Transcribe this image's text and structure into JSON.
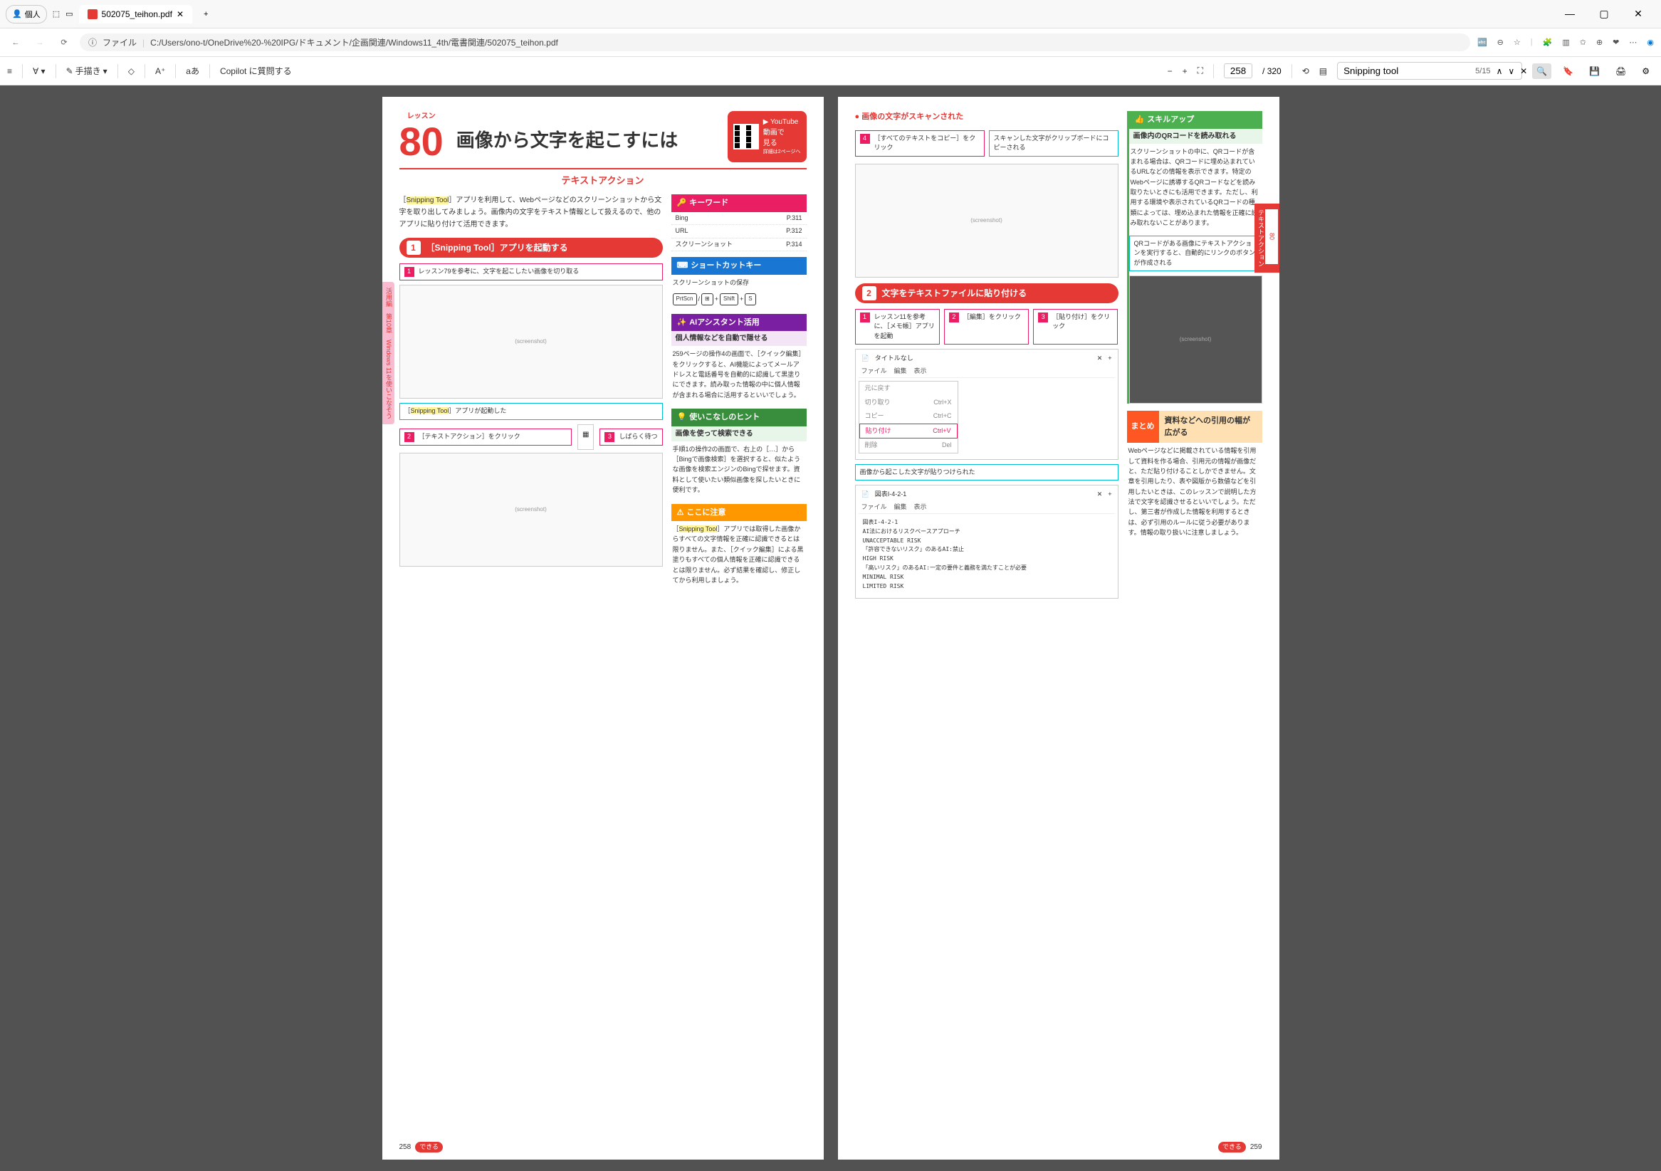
{
  "titlebar": {
    "profile": "個人",
    "tab_title": "502075_teihon.pdf"
  },
  "addressbar": {
    "file_label": "ファイル",
    "url": "C:/Users/ono-t/OneDrive%20-%20IPG/ドキュメント/企画関連/Windows11_4th/電書関連/502075_teihon.pdf"
  },
  "toolbar": {
    "draw": "手描き",
    "ask_copilot": "Copilot に質問する",
    "page_current": "258",
    "page_total": "/ 320",
    "search_value": "Snipping tool",
    "search_count": "5/15"
  },
  "left_page": {
    "lesson_label": "レッスン",
    "lesson_num": "80",
    "lesson_title": "画像から文字を起こすには",
    "qr_line1": "YouTube",
    "qr_line2": "動画で",
    "qr_line3": "見る",
    "qr_sub": "詳細は2ページへ",
    "subtitle": "テキストアクション",
    "intro": "［Snipping Tool］アプリを利用して、Webページなどのスクリーンショットから文字を取り出してみましょう。画像内の文字をテキスト情報として扱えるので、他のアプリに貼り付けて活用できます。",
    "intro_highlight": "Snipping Tool",
    "sec1_title": "［Snipping Tool］アプリを起動する",
    "step1_1": "レッスン79を参考に、文字を起こしたい画像を切り取る",
    "cyan1": "［Snipping Tool］アプリが起動した",
    "cyan1_highlight": "Snipping Tool",
    "step1_2": "［テキストアクション］をクリック",
    "step1_3": "しばらく待つ",
    "keyword_header": "キーワード",
    "keywords": [
      {
        "k": "Bing",
        "v": "P.311"
      },
      {
        "k": "URL",
        "v": "P.312"
      },
      {
        "k": "スクリーンショット",
        "v": "P.314"
      }
    ],
    "shortcut_header": "ショートカットキー",
    "shortcut_label": "スクリーンショットの保存",
    "shortcut_keys": [
      "PrtScn",
      "/",
      "⊞",
      "+",
      "Shift",
      "+",
      "S"
    ],
    "ai_header": "AIアシスタント活用",
    "ai_sub": "個人情報などを自動で隠せる",
    "ai_body": "259ページの操作4の画面で、［クイック編集］をクリックすると、AI機能によってメールアドレスと電話番号を自動的に認識して黒塗りにできます。読み取った情報の中に個人情報が含まれる場合に活用するといいでしょう。",
    "hint_header": "使いこなしのヒント",
    "hint_sub": "画像を使って検索できる",
    "hint_body": "手順1の操作2の画面で、右上の［…］から［Bingで画像検索］を選択すると、似たような画像を検索エンジンのBingで探せます。資料として使いたい類似画像を探したいときに便利です。",
    "warn_header": "ここに注意",
    "warn_body": "［Snipping Tool］アプリでは取得した画像からすべての文字情報を正確に認識できるとは限りません。また、［クイック編集］による黒塗りもすべての個人情報を正確に認識できるとは限りません。必ず結果を確認し、修正してから利用しましょう。",
    "warn_highlight": "Snipping Tool",
    "sidebar": "活用編　第10章　Windows 11を使いこなそう",
    "page_num": "258",
    "dekiru": "できる"
  },
  "right_page": {
    "scan_title": "画像の文字がスキャンされた",
    "step4": "［すべてのテキストをコピー］をクリック",
    "cyan4": "スキャンした文字がクリップボードにコピーされる",
    "sec2_title": "文字をテキストファイルに貼り付ける",
    "step2_1": "レッスン11を参考に、［メモ帳］アプリを起動",
    "step2_2": "［編集］をクリック",
    "step2_3": "［貼り付け］をクリック",
    "notepad_title": "タイトルなし",
    "notepad_menu": [
      "ファイル",
      "編集",
      "表示"
    ],
    "popup_items": [
      {
        "label": "元に戻す",
        "short": ""
      },
      {
        "label": "切り取り",
        "short": "Ctrl+X"
      },
      {
        "label": "コピー",
        "short": "Ctrl+C"
      },
      {
        "label": "貼り付け",
        "short": "Ctrl+V",
        "active": true
      },
      {
        "label": "削除",
        "short": "Del"
      }
    ],
    "cyan5": "画像から起こした文字が貼りつけられた",
    "result_title": "図表I-4-2-1",
    "result_lines": [
      "図表I-4-2-1",
      "AI法におけるリスクベースアプローチ",
      "UNACCEPTABLE RISK",
      "「許容できないリスク」のあるAI:禁止",
      "HIGH RISK",
      "「高いリスク」のあるAI:一定の要件と義務を満たすことが必要",
      "MINIMAL RISK",
      "LIMITED RISK"
    ],
    "skill_header": "スキルアップ",
    "skill_sub": "画像内のQRコードを読み取れる",
    "skill_body": "スクリーンショットの中に、QRコードが含まれる場合は、QRコードに埋め込まれているURLなどの情報を表示できます。特定のWebページに誘導するQRコードなどを読み取りたいときにも活用できます。ただし、利用する環境や表示されているQRコードの種類によっては、埋め込まれた情報を正確に読み取れないことがあります。",
    "skill_cyan": "QRコードがある画像にテキストアクションを実行すると、自動的にリンクのボタンが作成される",
    "summary_label": "まとめ",
    "summary_title": "資料などへの引用の幅が広がる",
    "summary_body": "Webページなどに掲載されている情報を引用して資料を作る場合、引用元の情報が画像だと、ただ貼り付けることしかできません。文章を引用したり、表や図版から数値などを引用したいときは、このレッスンで説明した方法で文字を認識させるといいでしょう。ただし、第三者が作成した情報を利用するときは、必ず引用のルールに従う必要があります。情報の取り扱いに注意しましょう。",
    "sidebar_num": "80",
    "sidebar_text": "テキストアクション",
    "page_num": "259",
    "dekiru": "できる"
  }
}
